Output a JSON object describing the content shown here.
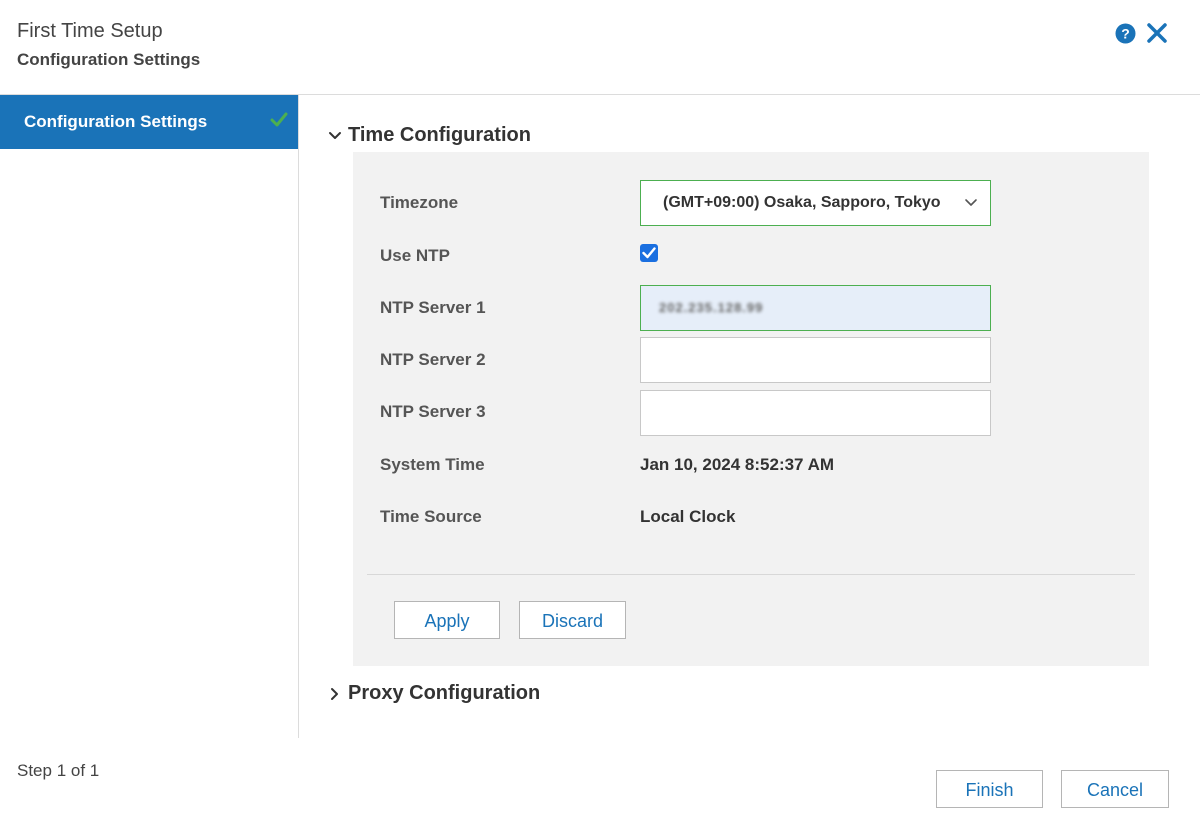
{
  "header": {
    "title": "First Time Setup",
    "subtitle": "Configuration Settings"
  },
  "sidebar": {
    "items": [
      {
        "label": "Configuration Settings",
        "completed": true
      }
    ]
  },
  "time_config": {
    "section_title": "Time Configuration",
    "expanded": true,
    "timezone_label": "Timezone",
    "timezone_value": "(GMT+09:00) Osaka, Sapporo, Tokyo",
    "use_ntp_label": "Use NTP",
    "use_ntp_checked": true,
    "ntp1_label": "NTP Server 1",
    "ntp1_value": "202.235.128.99",
    "ntp2_label": "NTP Server 2",
    "ntp2_value": "",
    "ntp3_label": "NTP Server 3",
    "ntp3_value": "",
    "system_time_label": "System Time",
    "system_time_value": "Jan 10, 2024 8:52:37 AM",
    "time_source_label": "Time Source",
    "time_source_value": "Local Clock",
    "apply_label": "Apply",
    "discard_label": "Discard"
  },
  "proxy_config": {
    "section_title": "Proxy Configuration",
    "expanded": false
  },
  "footer": {
    "step_text": "Step 1 of 1",
    "finish_label": "Finish",
    "cancel_label": "Cancel"
  },
  "colors": {
    "accent": "#1a73b8",
    "success": "#4caf50",
    "panel_bg": "#f2f2f2",
    "checkbox": "#1a6fe0"
  }
}
